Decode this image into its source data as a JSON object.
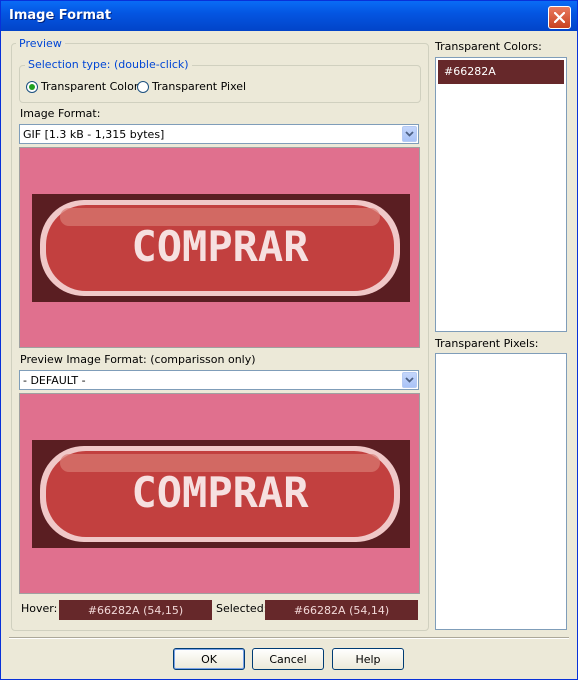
{
  "window": {
    "title": "Image Format"
  },
  "preview_group": {
    "legend": "Preview",
    "selection_type": {
      "legend": "Selection type: (double-click)",
      "options": [
        {
          "label": "Transparent Color",
          "checked": true
        },
        {
          "label": "Transparent Pixel",
          "checked": false
        }
      ]
    },
    "image_format": {
      "label": "Image Format:",
      "value": "GIF   [1.3 kB - 1,315 bytes]"
    },
    "preview_image_format": {
      "label": "Preview Image Format: (comparisson only)",
      "value": "- DEFAULT -"
    },
    "preview_image_text": "COMPRAR",
    "hover": {
      "label": "Hover:",
      "value": "#66282A (54,15)"
    },
    "selected": {
      "label": "Selected:",
      "value": "#66282A (54,14)"
    }
  },
  "transparent_colors": {
    "label": "Transparent Colors:",
    "items": [
      "#66282A"
    ]
  },
  "transparent_pixels": {
    "label": "Transparent Pixels:",
    "items": []
  },
  "buttons": {
    "ok": "OK",
    "cancel": "Cancel",
    "help": "Help"
  },
  "colors": {
    "accent": "#0046d5",
    "swatch": "#66282A",
    "preview_bg": "#E0708E",
    "button_red": "#C2403F"
  },
  "icons": {
    "close": "close-icon",
    "combo_arrow": "chevron-down-icon",
    "radio": "radio-icon"
  }
}
